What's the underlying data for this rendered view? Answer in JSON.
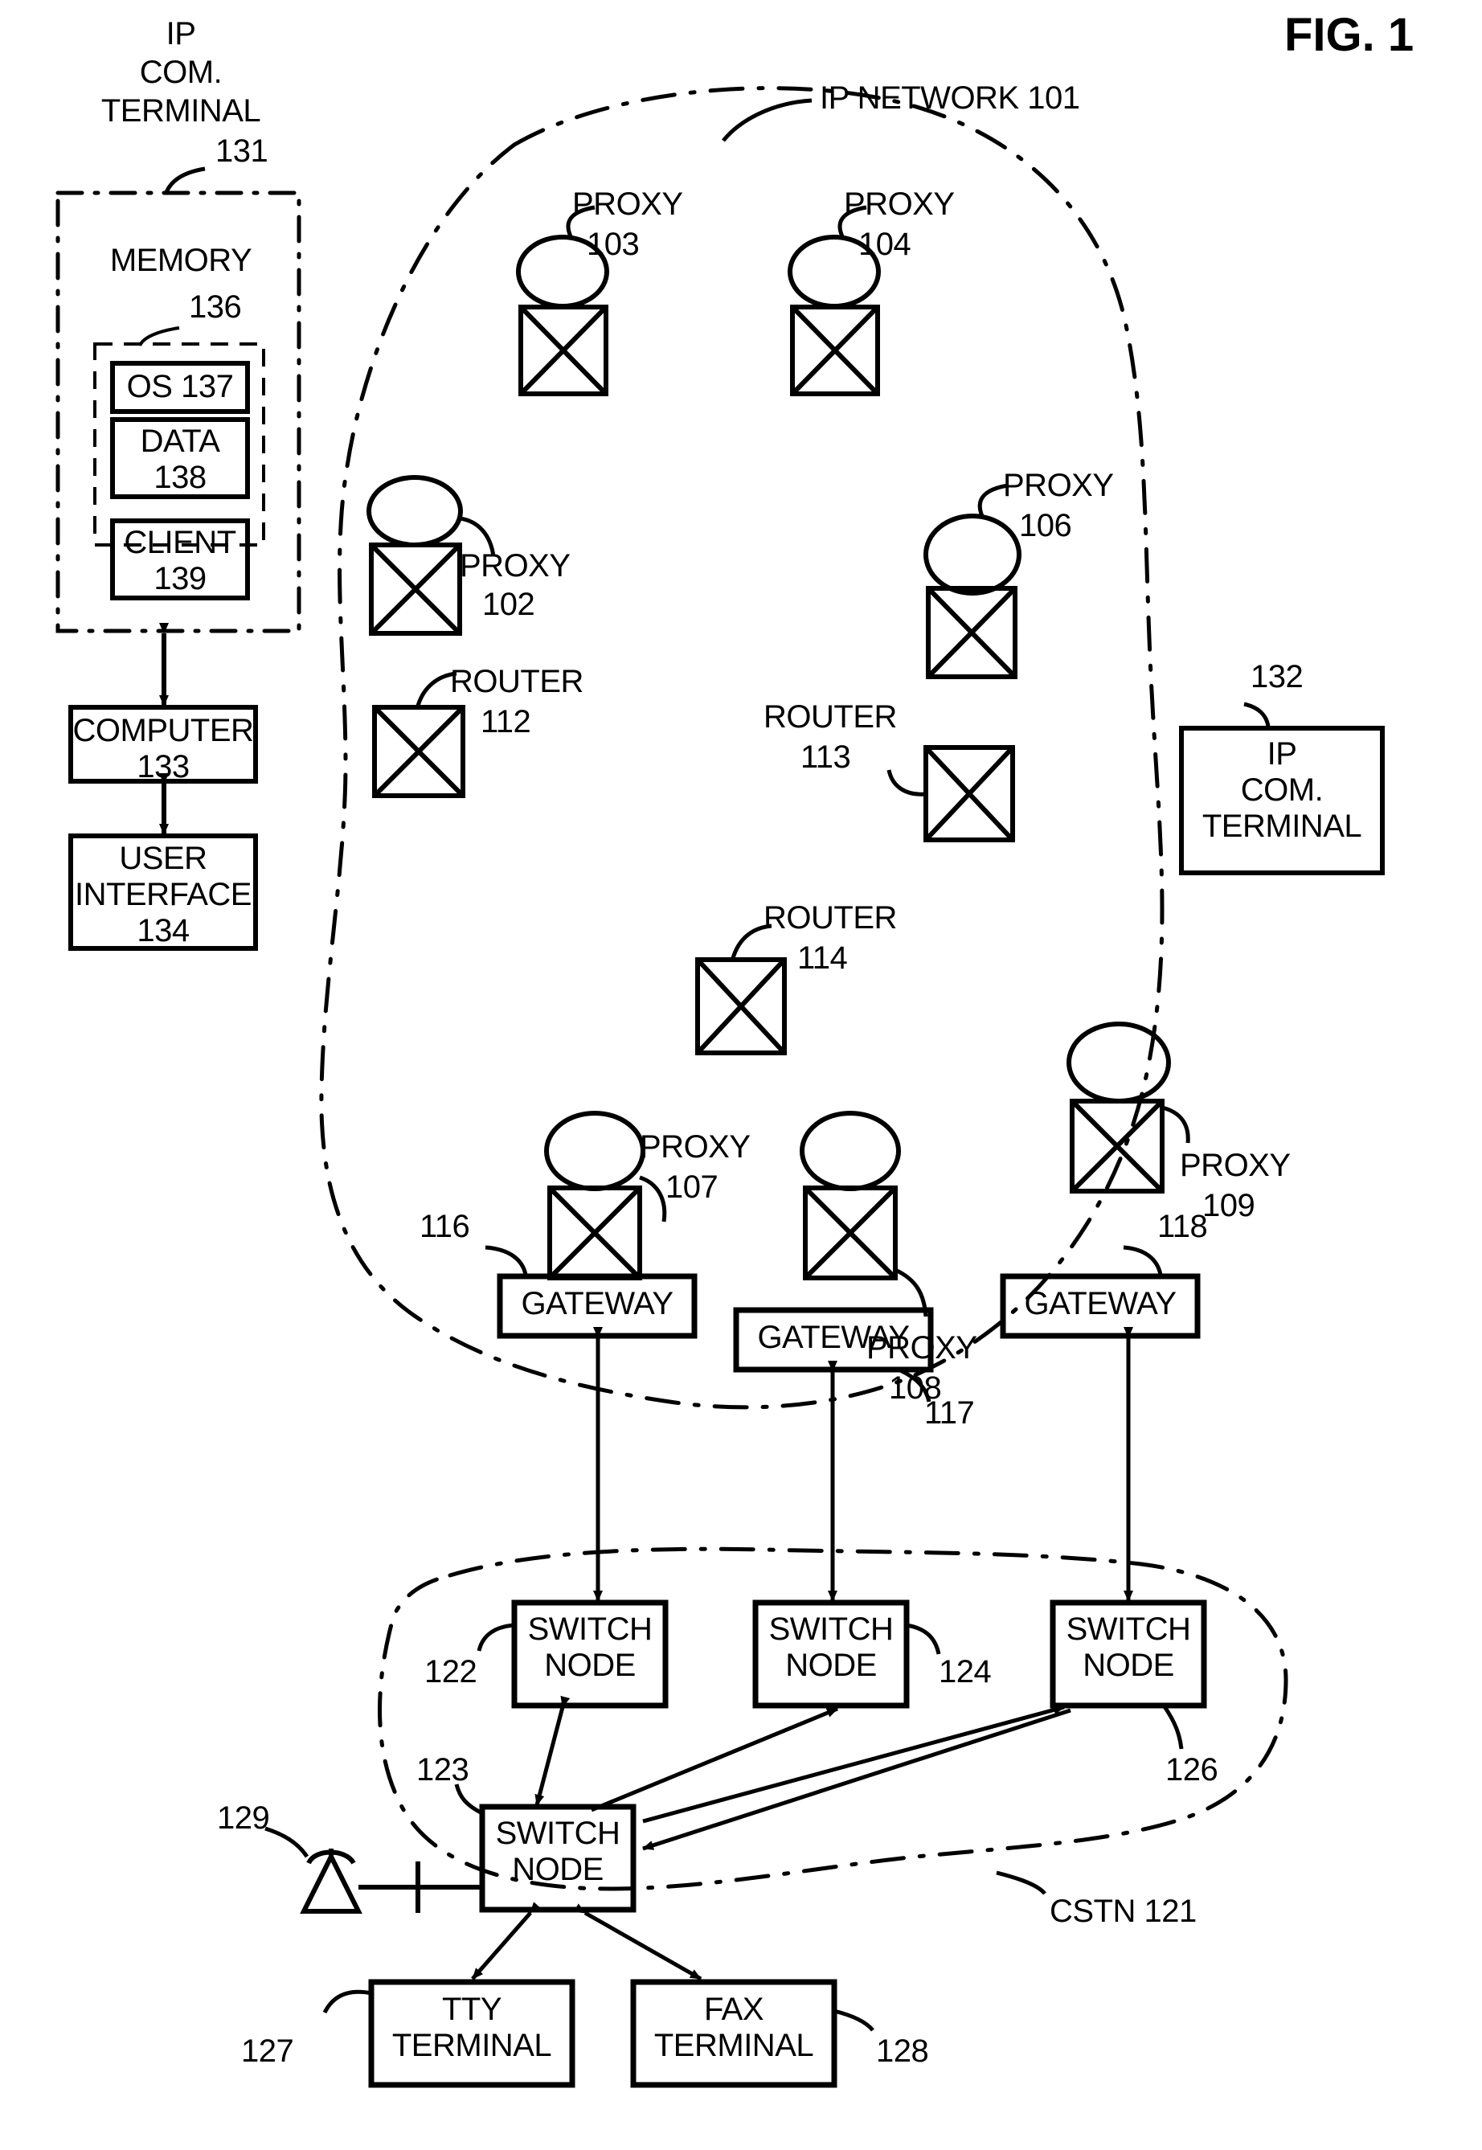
{
  "figure": {
    "title": "FIG. 1",
    "network_label": "IP NETWORK 101",
    "cstn_label": "CSTN 121"
  },
  "terminal_131": {
    "title_line1": "IP",
    "title_line2": "COM.",
    "title_line3": "TERMINAL",
    "ref": "131",
    "memory_label": "MEMORY",
    "memory_ref": "136",
    "blocks": [
      {
        "label": "OS 137",
        "name": "os-block"
      },
      {
        "label": "DATA\n138",
        "name": "data-block"
      },
      {
        "label": "CLIENT\n139",
        "name": "client-block"
      }
    ],
    "computer_label": "COMPUTER\n133",
    "user_interface_label": "USER\nINTERFACE\n134"
  },
  "terminal_132": {
    "ref": "132",
    "label": "IP\nCOM.\nTERMINAL"
  },
  "proxies": [
    {
      "id": "proxy-103",
      "label": "PROXY",
      "ref": "103"
    },
    {
      "id": "proxy-104",
      "label": "PROXY",
      "ref": "104"
    },
    {
      "id": "proxy-102",
      "label": "PROXY",
      "ref": "102"
    },
    {
      "id": "proxy-106",
      "label": "PROXY",
      "ref": "106"
    },
    {
      "id": "proxy-107",
      "label": "PROXY",
      "ref": "107"
    },
    {
      "id": "proxy-108",
      "label": "PROXY",
      "ref": "108"
    },
    {
      "id": "proxy-109",
      "label": "PROXY",
      "ref": "109"
    }
  ],
  "routers": [
    {
      "id": "router-112",
      "label": "ROUTER",
      "ref": "112"
    },
    {
      "id": "router-113",
      "label": "ROUTER",
      "ref": "113"
    },
    {
      "id": "router-114",
      "label": "ROUTER",
      "ref": "114"
    }
  ],
  "gateways": [
    {
      "id": "gateway-116",
      "label": "GATEWAY",
      "ref": "116"
    },
    {
      "id": "gateway-117",
      "label": "GATEWAY",
      "ref": "117"
    },
    {
      "id": "gateway-118",
      "label": "GATEWAY",
      "ref": "118"
    }
  ],
  "switch_nodes": [
    {
      "id": "switch-node-122",
      "label": "SWITCH\nNODE",
      "ref": "122"
    },
    {
      "id": "switch-node-124",
      "label": "SWITCH\nNODE",
      "ref": "124"
    },
    {
      "id": "switch-node-126",
      "label": "SWITCH\nNODE",
      "ref": "126"
    },
    {
      "id": "switch-node-123",
      "label": "SWITCH\nNODE",
      "ref": "123"
    }
  ],
  "terminals": [
    {
      "id": "tty-terminal",
      "label": "TTY\nTERMINAL",
      "ref": "127"
    },
    {
      "id": "fax-terminal",
      "label": "FAX\nTERMINAL",
      "ref": "128"
    }
  ],
  "antenna": {
    "ref": "129"
  }
}
